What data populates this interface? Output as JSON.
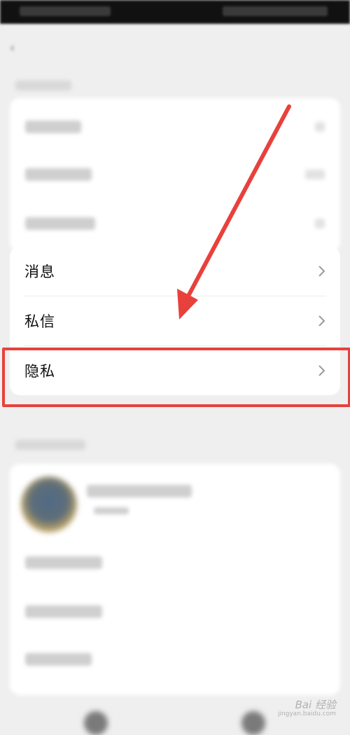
{
  "settings": {
    "items": [
      {
        "label": "消息"
      },
      {
        "label": "私信"
      },
      {
        "label": "隐私"
      }
    ]
  },
  "icons": {
    "chevron": "chevron-right-icon",
    "back": "back-arrow-icon"
  },
  "colors": {
    "highlight": "#e8413c",
    "card": "#ffffff",
    "background": "#efefef"
  },
  "watermark": {
    "brand": "Bai 经验",
    "url": "jingyan.baidu.com"
  }
}
